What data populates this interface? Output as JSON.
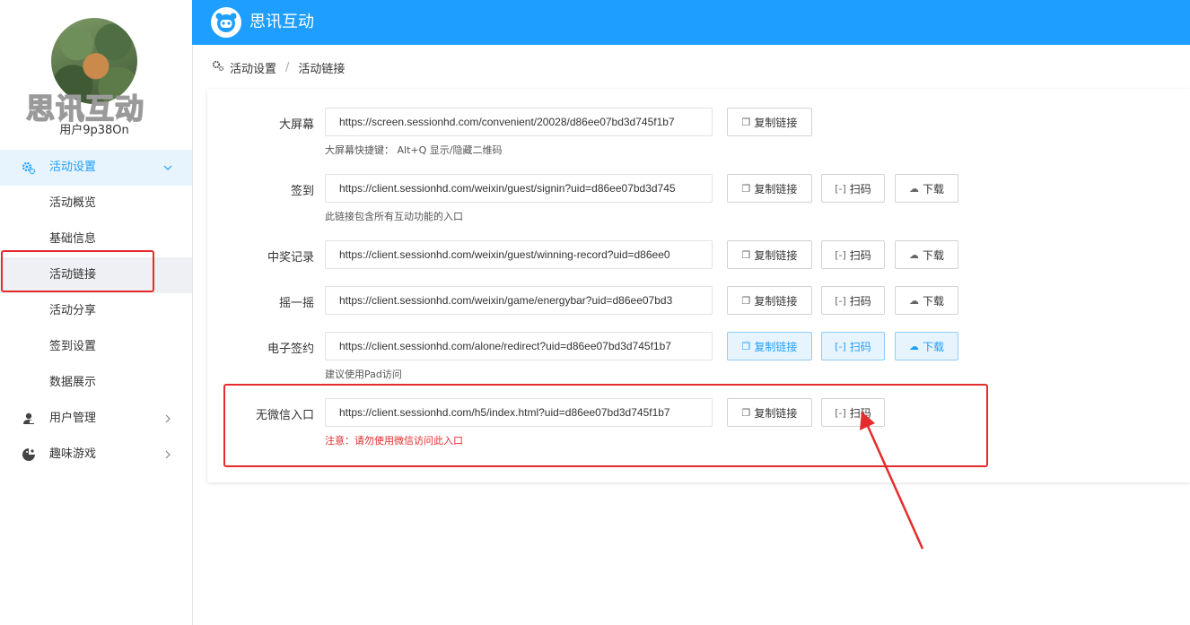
{
  "sidebar": {
    "brand": "思讯互动",
    "username": "用户9p38On",
    "menu": [
      {
        "label": "活动设置",
        "icon": "gears-icon",
        "expanded": true
      },
      {
        "label": "用户管理",
        "icon": "user-manage-icon"
      },
      {
        "label": "趣味游戏",
        "icon": "game-icon"
      }
    ],
    "sub_items": [
      "活动概览",
      "基础信息",
      "活动链接",
      "活动分享",
      "签到设置",
      "数据展示"
    ],
    "current_sub": "活动链接"
  },
  "header": {
    "title": "思讯互动",
    "color": "#1e9fff"
  },
  "breadcrumb": {
    "items": [
      "活动设置",
      "活动链接"
    ],
    "separator": "/"
  },
  "buttons": {
    "copy": "复制链接",
    "scan": "扫码",
    "download": "下载"
  },
  "links": [
    {
      "label": "大屏幕",
      "url": "https://screen.sessionhd.com/convenient/20028/d86ee07bd3d745f1b7",
      "hint": "大屏幕快捷键： Alt+Q 显示/隐藏二维码"
    },
    {
      "label": "签到",
      "url": "https://client.sessionhd.com/weixin/guest/signin?uid=d86ee07bd3d745",
      "hint": "此链接包含所有互动功能的入口"
    },
    {
      "label": "中奖记录",
      "url": "https://client.sessionhd.com/weixin/guest/winning-record?uid=d86ee0"
    },
    {
      "label": "摇一摇",
      "url": "https://client.sessionhd.com/weixin/game/energybar?uid=d86ee07bd3"
    },
    {
      "label": "电子签约",
      "url": "https://client.sessionhd.com/alone/redirect?uid=d86ee07bd3d745f1b7",
      "hint": "建议使用Pad访问"
    },
    {
      "label": "无微信入口",
      "url": "https://client.sessionhd.com/h5/index.html?uid=d86ee07bd3d745f1b7",
      "hint": "注意：请勿使用微信访问此入口"
    }
  ],
  "colors": {
    "accent": "#1e9fff",
    "annotation": "#e52b2b",
    "warning_text": "#e52b2b"
  }
}
